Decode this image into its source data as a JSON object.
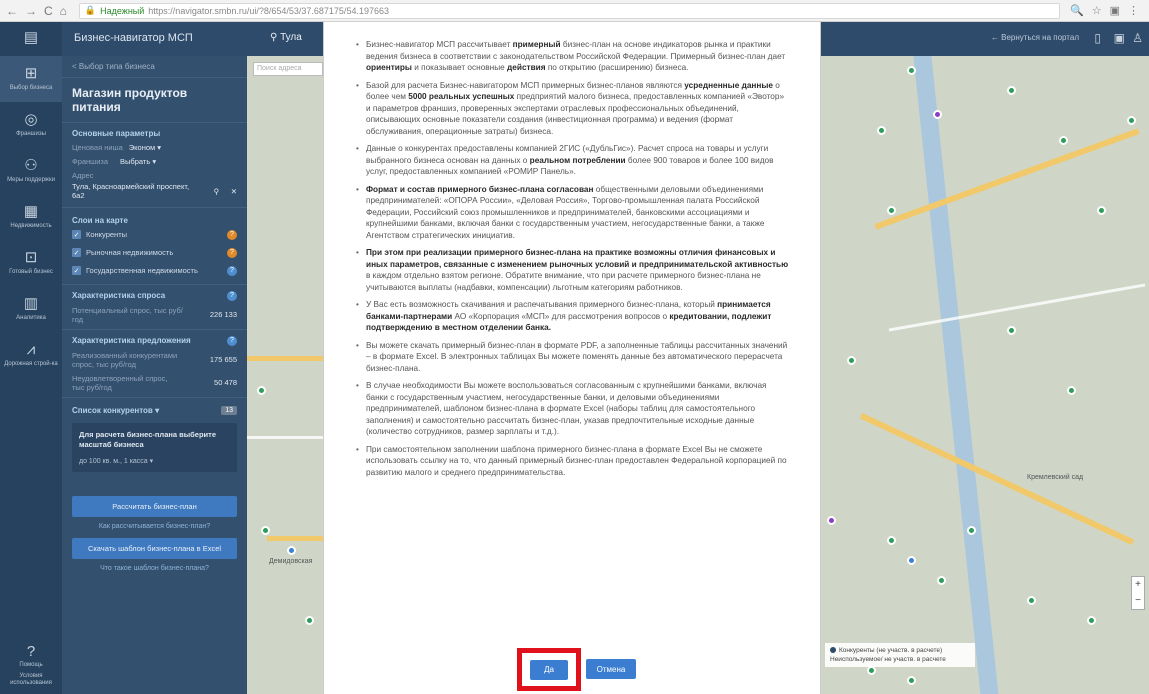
{
  "browser": {
    "secure_label": "Надежный",
    "url": "https://navigator.smbn.ru/ui/?8/654/53/37.687175/54.197663"
  },
  "rail": {
    "items": [
      {
        "label": "Выбор бизнеса"
      },
      {
        "label": "Франшизы"
      },
      {
        "label": "Меры поддержки"
      },
      {
        "label": "Недвижимость"
      },
      {
        "label": "Готовый бизнес"
      },
      {
        "label": "Аналитика"
      },
      {
        "label": "Дорожная строй-ка"
      }
    ],
    "help": "Помощь",
    "help_sub": "Условия использования"
  },
  "header": {
    "brand": "Бизнес-навигатор МСП",
    "city": "Тула",
    "back": "Вернуться на портал"
  },
  "panel": {
    "back_link": "< Выбор типа бизнеса",
    "title": "Магазин продуктов питания",
    "basic_params_title": "Основные параметры",
    "price_niche_label": "Ценовая ниша",
    "price_niche_value": "Эконом",
    "franchise_label": "Франшиза",
    "franchise_value": "Выбрать",
    "address_label": "Адрес",
    "address_value": "Тула, Красноармейский проспект, 6а2",
    "layers_title": "Слои на карте",
    "layer_competitors": "Конкуренты",
    "layer_market": "Рыночная недвижимость",
    "layer_state": "Государственная недвижимость",
    "demand_title": "Характеристика спроса",
    "demand_label": "Потенциальный спрос, тыс руб/год",
    "demand_value": "226 133",
    "supply_title": "Характеристика предложения",
    "supply_realized_label": "Реализованный конкурентами спрос, тыс руб/год",
    "supply_realized_value": "175 655",
    "supply_unmet_label": "Неудовлетворенный спрос, тыс руб/год",
    "supply_unmet_value": "50 478",
    "competitors_list": "Список конкурентов",
    "competitors_count": "13",
    "helpbox_title": "Для расчета бизнес-плана выберите масштаб бизнеса",
    "helpbox_select": "до 100 кв. м., 1 касса",
    "calc_button": "Рассчитать бизнес-план",
    "calc_link": "Как рассчитывается бизнес-план?",
    "download_button": "Скачать шаблон бизнес-плана в Excel",
    "template_link": "Что такое шаблон бизнес-плана?"
  },
  "map": {
    "search_placeholder": "Поиск адреса",
    "legend_1": "Конкуренты (не участв. в расчете)",
    "legend_2": "Неиспользуемое/ не участв. в расчете",
    "label_1": "Кремлевский сад",
    "label_2": "Демидовская"
  },
  "modal": {
    "p1_a": "Бизнес-навигатор МСП рассчитывает ",
    "p1_b": "примерный",
    "p1_c": " бизнес-план на основе индикаторов рынка и практики ведения бизнеса в соответствии с законодательством Российской Федерации. Примерный бизнес-план дает ",
    "p1_d": "ориентиры",
    "p1_e": " и показывает основные ",
    "p1_f": "действия",
    "p1_g": " по открытию (расширению) бизнеса.",
    "p2_a": "Базой для расчета Бизнес-навигатором МСП примерных бизнес-планов являются ",
    "p2_b": "усредненные данные",
    "p2_c": " о более чем ",
    "p2_d": "5000 реальных успешных",
    "p2_e": " предприятий малого бизнеса, предоставленных компанией «Эвотор» и параметров франшиз, проверенных экспертами отраслевых профессиональных объединений, описывающих основные показатели создания (инвестиционная программа) и ведения (формат обслуживания, операционные затраты) бизнеса.",
    "p3_a": "Данные о конкурентах предоставлены компанией 2ГИС («ДубльГис»). Расчет спроса на товары и услуги выбранного бизнеса основан на данных о ",
    "p3_b": "реальном потреблении",
    "p3_c": " более 900 товаров и более 100 видов услуг, предоставленных компанией «РОМИР Панель».",
    "p4_a": "Формат и состав примерного бизнес-плана согласован",
    "p4_b": " общественными деловыми объединениями предпринимателей: «ОПОРА России», «Деловая Россия», Торгово-промышленная палата Российской Федерации, Российский союз промышленников и предпринимателей, банковскими ассоциациями и крупнейшими банками, включая банки с государственным участием, негосударственные банки, а также Агентством стратегических инициатив.",
    "p5_a": "При этом при реализации примерного бизнес-плана на практике возможны отличия финансовых и иных параметров, связанные с изменением рыночных условий и предпринимательской активностью",
    "p5_b": " в каждом отдельно взятом регионе. Обратите внимание, что при расчете примерного бизнес-плана не учитываются выплаты (надбавки, компенсации) льготным категориям работников.",
    "p6_a": "У Вас есть возможность скачивания и распечатывания примерного бизнес-плана, который ",
    "p6_b": "принимается банками-партнерами",
    "p6_c": " АО «Корпорация «МСП» для рассмотрения вопросов о ",
    "p6_d": "кредитовании, подлежит подтверждению в местном отделении банка.",
    "p7": "Вы можете скачать примерный бизнес-план в формате PDF, а заполненные таблицы рассчитанных значений – в формате Excel. В электронных таблицах Вы можете поменять данные без автоматического перерасчета бизнес-плана.",
    "p8": "В случае необходимости Вы можете воспользоваться согласованным с крупнейшими банками, включая банки с государственным участием, негосударственные банки, и деловыми объединениями предпринимателей, шаблоном бизнес-плана в формате Excel (наборы таблиц для самостоятельного заполнения) и самостоятельно рассчитать бизнес-план, указав предпочтительные исходные данные (количество сотрудников, размер зарплаты и т.д.).",
    "p9": "При самостоятельном заполнении шаблона примерного бизнес-плана в формате Excel Вы не сможете использовать ссылку на то, что данный примерный бизнес-план предоставлен Федеральной корпорацией по развитию малого и среднего предпринимательства.",
    "yes_button": "Да",
    "cancel_button": "Отмена"
  }
}
